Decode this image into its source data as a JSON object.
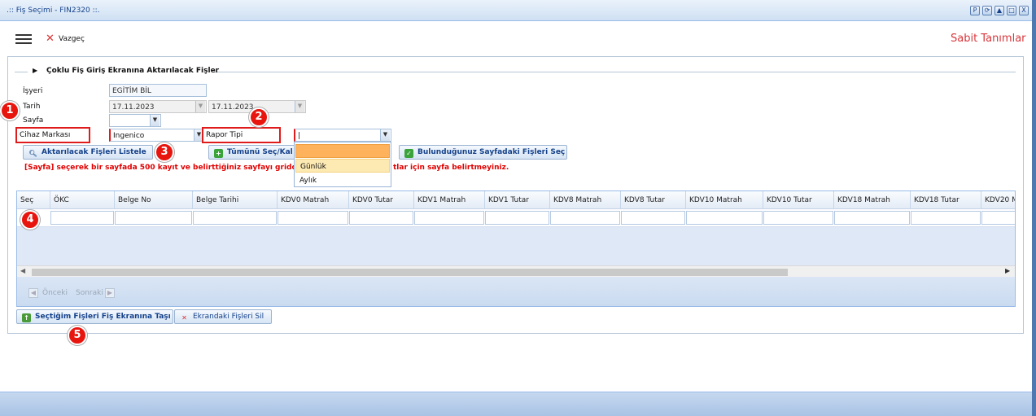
{
  "window": {
    "title": ".:: Fiş Seçimi - FIN2320 ::.",
    "controls": [
      "P",
      "⟳",
      "▲",
      "□",
      "X"
    ]
  },
  "toolbar": {
    "menu_icon": "hamburger-icon",
    "cancel_label": "Vazgeç",
    "cancel_icon": "close-icon",
    "right_link": "Sabit Tanımlar"
  },
  "panel": {
    "legend": "Çoklu Fiş Giriş Ekranına Aktarılacak Fişler"
  },
  "form": {
    "isyeri_label": "İşyeri",
    "isyeri_value": "EGİTİM BİL",
    "tarih_label": "Tarih",
    "tarih_from": "17.11.2023",
    "tarih_to": "17.11.2023",
    "sayfa_label": "Sayfa",
    "sayfa_value": "",
    "cihaz_label": "Cihaz Markası",
    "cihaz_value": "Ingenico",
    "rapor_label": "Rapor Tipi",
    "rapor_value": "|"
  },
  "buttons": {
    "list": "Aktarılacak Fişleri Listele",
    "select_all": "Tümünü Seç/Kal",
    "select_page": "Bulunduğunuz Sayfadaki Fişleri Seç",
    "move": "Seçtiğim Fişleri Fiş Ekranına Taşı",
    "delete": "Ekrandaki Fişleri Sil"
  },
  "warning_left": "[Sayfa] seçerek bir sayfada 500 kayıt ve belirttiğiniz sayfayı gridde lis",
  "warning_right": "tlar için sayfa belirtmeyiniz.",
  "dropdown": {
    "options": [
      "",
      "Günlük",
      "Aylık"
    ],
    "selected_index": 0,
    "hover_index": 1
  },
  "grid": {
    "columns": [
      "Seç",
      "ÖKC",
      "Belge No",
      "Belge Tarihi",
      "KDV0 Matrah",
      "KDV0 Tutar",
      "KDV1 Matrah",
      "KDV1 Tutar",
      "KDV8 Matrah",
      "KDV8 Tutar",
      "KDV10 Matrah",
      "KDV10 Tutar",
      "KDV18 Matrah",
      "KDV18 Tutar",
      "KDV20 M"
    ],
    "pager_prev": "Önceki",
    "pager_next": "Sonraki"
  },
  "markers": [
    "1",
    "2",
    "3",
    "4",
    "5"
  ],
  "colors": {
    "accent_red": "#e01b1b",
    "header_blue": "#15428b",
    "dropdown_selected": "#ffb25c",
    "dropdown_hover": "#fde9b2"
  }
}
